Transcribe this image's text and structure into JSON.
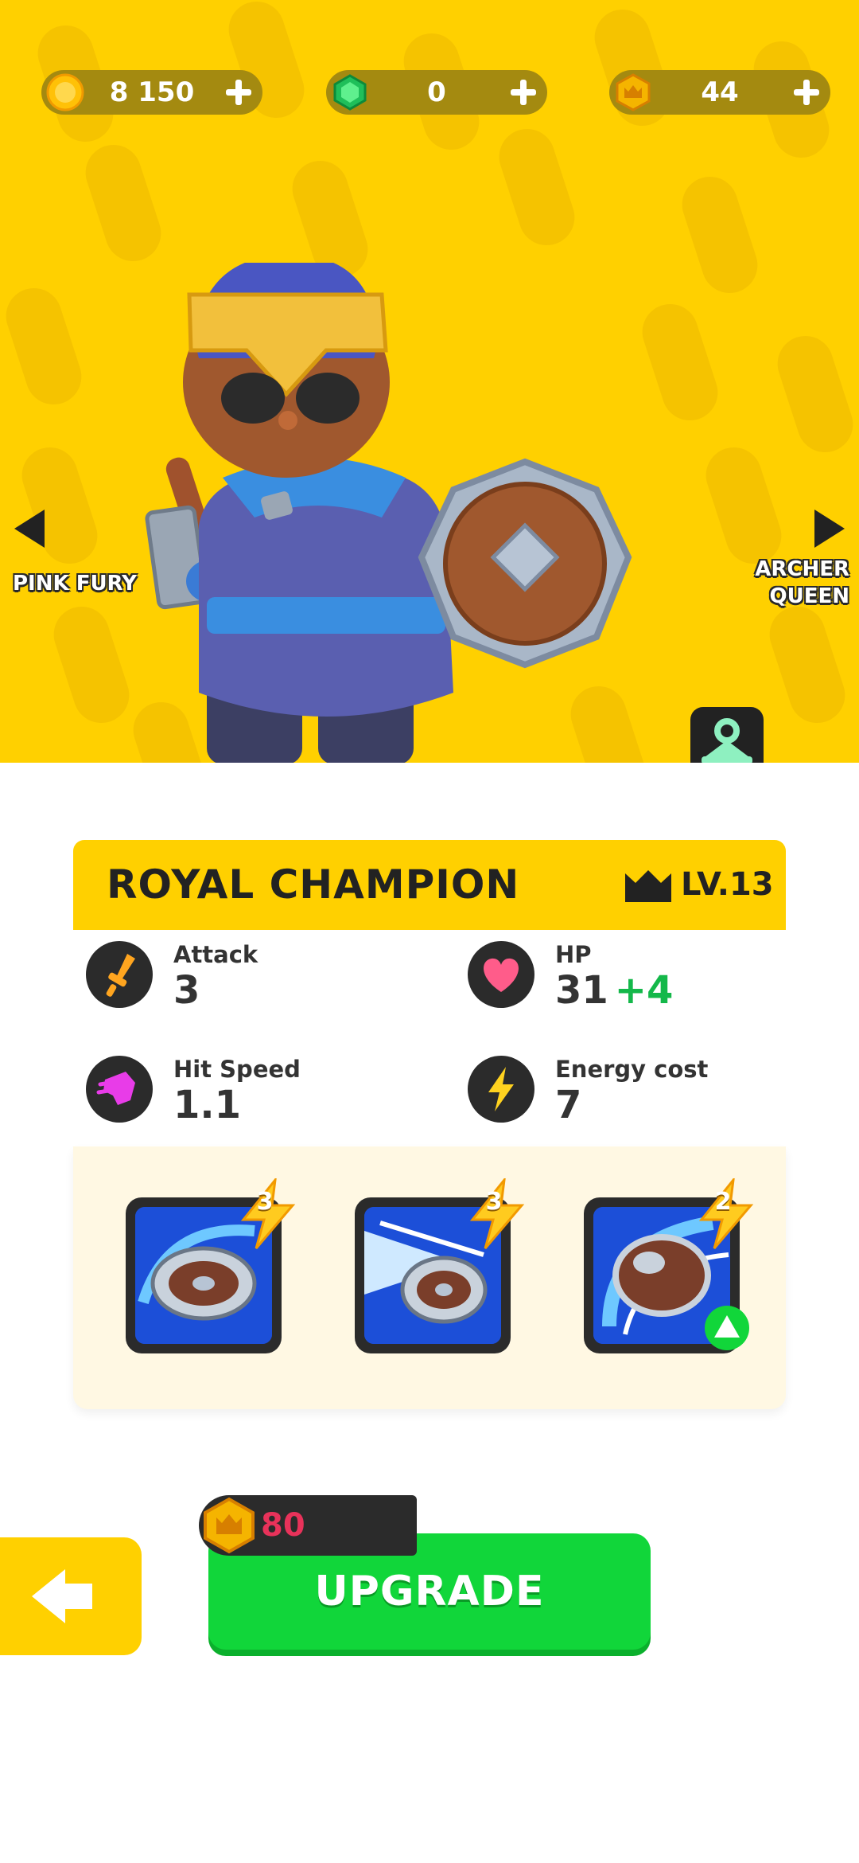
{
  "currencies": [
    {
      "name": "coins",
      "value": "8 150",
      "icon": "coin-icon",
      "color": "#ffc107"
    },
    {
      "name": "gems",
      "value": "0",
      "icon": "gem-icon",
      "color": "#1fbf5a"
    },
    {
      "name": "trophies",
      "value": "44",
      "icon": "crown-token-icon",
      "color": "#f5b400"
    }
  ],
  "navigation": {
    "previous_label": "PINK FURY",
    "next_label_line1": "ARCHER",
    "next_label_line2": "QUEEN"
  },
  "hero": {
    "background_color": "#ffd000",
    "wardrobe_icon": "hanger-icon"
  },
  "card": {
    "title": "ROYAL CHAMPION",
    "level": "LV.13",
    "level_icon": "crown-icon"
  },
  "stats": [
    {
      "label": "Attack",
      "value": "3",
      "bonus": "",
      "icon": "sword-icon",
      "icon_color": "#ffa51f"
    },
    {
      "label": "HP",
      "value": "31",
      "bonus": "+4",
      "icon": "heart-icon",
      "icon_color": "#ff5c8a"
    },
    {
      "label": "Hit Speed",
      "value": "1.1",
      "bonus": "",
      "icon": "fist-icon",
      "icon_color": "#e83ce8"
    },
    {
      "label": "Energy cost",
      "value": "7",
      "bonus": "",
      "icon": "energy-icon",
      "icon_color": "#ffd21f"
    }
  ],
  "skills": [
    {
      "level": "3",
      "icon": "shield-spin-icon",
      "upgradable": false
    },
    {
      "level": "3",
      "icon": "shield-dash-icon",
      "upgradable": false
    },
    {
      "level": "2",
      "icon": "shield-throw-icon",
      "upgradable": true
    }
  ],
  "upgrade": {
    "label": "UPGRADE",
    "cost": "80",
    "cost_icon": "crown-token-icon",
    "cost_color": "#e8325a",
    "button_color": "#11d63a"
  },
  "back_button": {
    "icon": "arrow-left-icon"
  }
}
